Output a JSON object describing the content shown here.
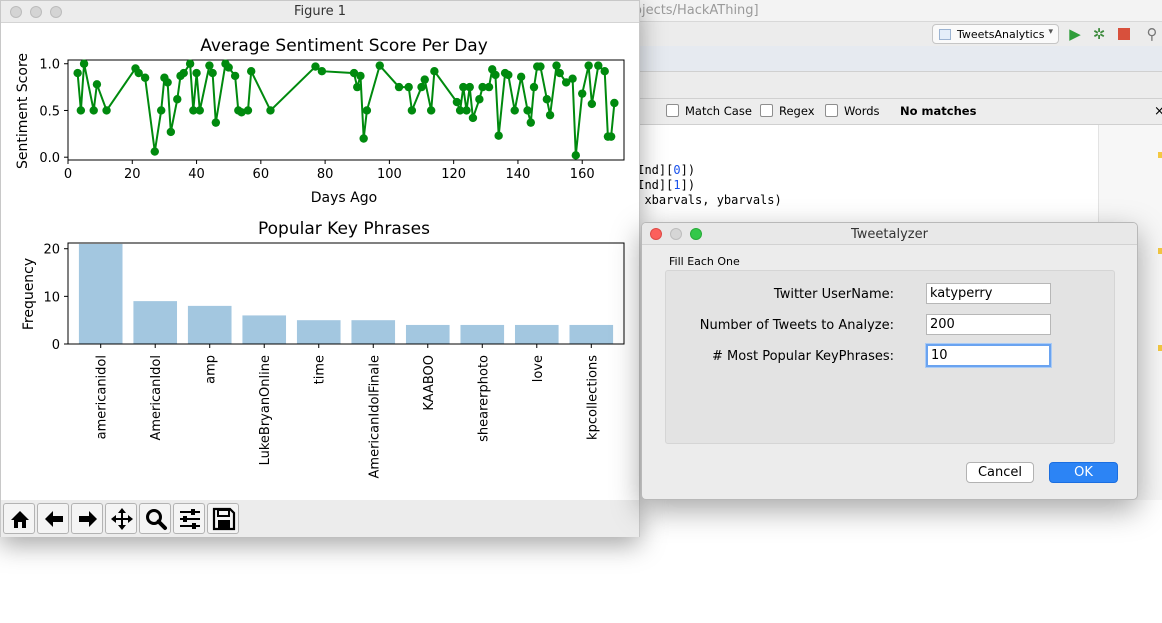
{
  "ide": {
    "title_fragment": "ojects/HackAThing]",
    "run_config": "TweetsAnalytics",
    "find": {
      "match_case": "Match Case",
      "regex": "Regex",
      "words": "Words",
      "status": "No matches"
    },
    "code_lines": [
      {
        "prefix": "rInd][",
        "num": "0",
        "suffix": "])"
      },
      {
        "prefix": "rInd][",
        "num": "1",
        "suffix": "])"
      },
      {
        "prefix": ", xbarvals, ybarvals)",
        "num": "",
        "suffix": ""
      }
    ]
  },
  "figure_window": {
    "title": "Figure 1"
  },
  "chart_data": [
    {
      "type": "line",
      "title": "Average Sentiment Score Per Day",
      "xlabel": "Days Ago",
      "ylabel": "Sentiment Score",
      "xlim": [
        0,
        173
      ],
      "ylim": [
        -0.03,
        1.04
      ],
      "xticks": [
        0,
        20,
        40,
        60,
        80,
        100,
        120,
        140,
        160
      ],
      "yticks": [
        0.0,
        0.5,
        1.0
      ],
      "ytick_labels": [
        "0.0",
        "0.5",
        "1.0"
      ],
      "color": "#008a0e",
      "x": [
        3,
        4,
        5,
        8,
        9,
        12,
        21,
        22,
        24,
        27,
        29,
        30,
        31,
        32,
        34,
        35,
        36,
        38,
        39,
        40,
        41,
        44,
        45,
        46,
        49,
        50,
        52,
        53,
        54,
        56,
        57,
        63,
        77,
        79,
        89,
        90,
        91,
        92,
        93,
        97,
        103,
        106,
        107,
        110,
        111,
        113,
        114,
        121,
        122,
        123,
        124,
        125,
        126,
        128,
        129,
        131,
        132,
        133,
        134,
        136,
        137,
        139,
        141,
        143,
        144,
        145,
        146,
        147,
        149,
        150,
        152,
        153,
        155,
        157,
        158,
        160,
        162,
        163,
        165,
        167,
        168,
        169,
        170
      ],
      "y": [
        0.9,
        0.5,
        1.0,
        0.5,
        0.78,
        0.5,
        0.95,
        0.9,
        0.85,
        0.06,
        0.5,
        0.85,
        0.8,
        0.27,
        0.62,
        0.87,
        0.9,
        1.0,
        0.5,
        0.9,
        0.5,
        0.98,
        0.9,
        0.37,
        1.0,
        0.96,
        0.87,
        0.5,
        0.48,
        0.5,
        0.92,
        0.5,
        0.97,
        0.92,
        0.9,
        0.75,
        0.87,
        0.2,
        0.5,
        0.98,
        0.75,
        0.75,
        0.5,
        0.75,
        0.83,
        0.5,
        0.92,
        0.59,
        0.5,
        0.75,
        0.5,
        0.75,
        0.42,
        0.62,
        0.75,
        0.75,
        0.94,
        0.88,
        0.23,
        0.9,
        0.88,
        0.5,
        0.86,
        0.5,
        0.37,
        0.75,
        0.97,
        0.97,
        0.62,
        0.45,
        0.98,
        0.9,
        0.8,
        0.84,
        0.02,
        0.68,
        0.98,
        0.57,
        0.98,
        0.92,
        0.22,
        0.22,
        0.58
      ]
    },
    {
      "type": "bar",
      "title": "Popular Key Phrases",
      "xlabel": "",
      "ylabel": "Frequency",
      "ylim": [
        0,
        21.2
      ],
      "yticks": [
        0,
        10,
        20
      ],
      "color": "#a3c7e0",
      "categories": [
        "americanidol",
        "AmericanIdol",
        "amp",
        "LukeBryanOnline",
        "time",
        "AmericanIdolFinale",
        "KAABOO",
        "shearerphoto",
        "love",
        "kpcollections"
      ],
      "values": [
        21,
        9,
        8,
        6,
        5,
        5,
        4,
        4,
        4,
        4
      ]
    }
  ],
  "toolbar_icons": [
    "home-icon",
    "back-arrow-icon",
    "forward-arrow-icon",
    "pan-icon",
    "zoom-icon",
    "configure-subplots-icon",
    "save-icon"
  ],
  "dialog": {
    "title": "Tweetalyzer",
    "section_label": "Fill Each One",
    "fields": [
      {
        "label": "Twitter UserName:",
        "value": "katyperry"
      },
      {
        "label": "Number of Tweets to Analyze:",
        "value": "200"
      },
      {
        "label": "# Most Popular KeyPhrases:",
        "value": "10"
      }
    ],
    "cancel_label": "Cancel",
    "ok_label": "OK",
    "ok_color": "#2c84f5"
  }
}
